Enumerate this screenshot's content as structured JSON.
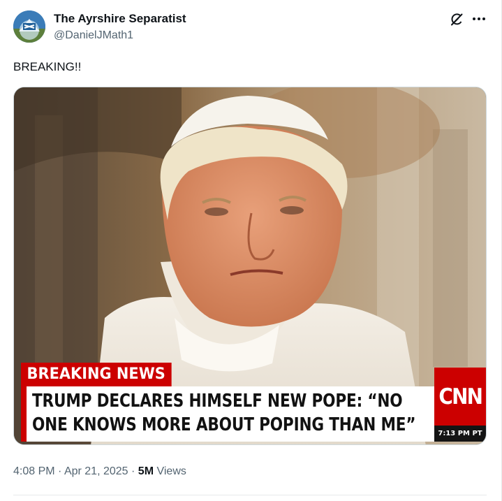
{
  "author": {
    "display_name": "The Ayrshire Separatist",
    "handle": "@DanielJMath1"
  },
  "post": {
    "text": "BREAKING!!"
  },
  "media": {
    "banner_label": "BREAKING NEWS",
    "headline_line1": "TRUMP DECLARES HIMSELF NEW POPE: “NO",
    "headline_line2": "ONE KNOWS MORE ABOUT POPING THAN ME”",
    "network_logo": "CNN",
    "time": "7:13 PM PT"
  },
  "meta": {
    "time": "4:08 PM",
    "separator": "·",
    "date": "Apr 21, 2025",
    "views_count": "5M",
    "views_label": "Views"
  },
  "icons": {
    "grok": "grok-icon",
    "more": "more-icon"
  },
  "colors": {
    "text": "#0f1419",
    "secondary": "#536471",
    "cnn_red": "#cc0000",
    "border": "#cfd9de"
  }
}
